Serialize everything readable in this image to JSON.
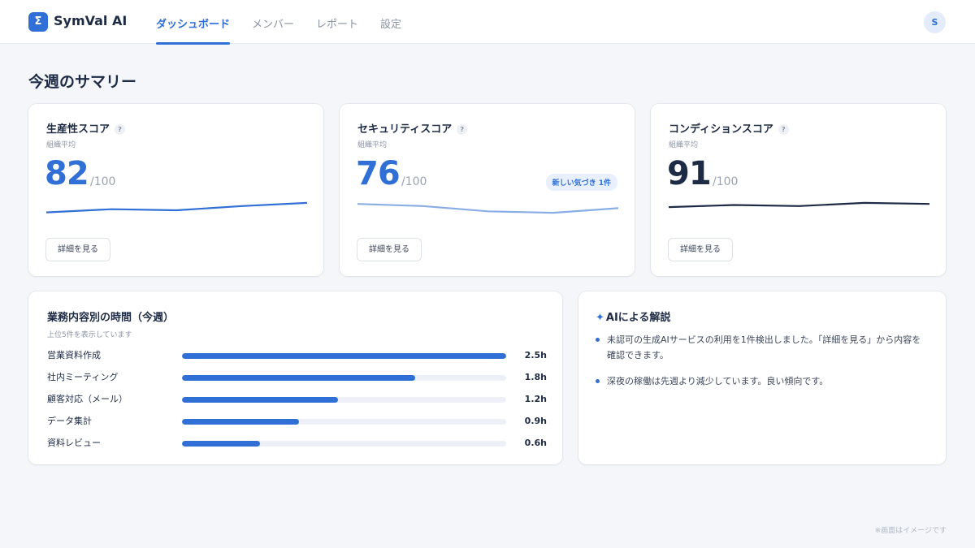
{
  "app": {
    "logo_glyph": "Σ",
    "name": "SymVal AI"
  },
  "nav": {
    "tabs": [
      {
        "label": "ダッシュボード",
        "active": true
      },
      {
        "label": "メンバー",
        "active": false
      },
      {
        "label": "レポート",
        "active": false
      },
      {
        "label": "設定",
        "active": false
      }
    ]
  },
  "user": {
    "avatar_initial": "S"
  },
  "page": {
    "title": "今週のサマリー"
  },
  "help_glyph": "?",
  "score_cards": [
    {
      "title": "生産性スコア",
      "subtitle": "組織平均",
      "value": "82",
      "max": "/100",
      "value_color": "#2f6fd6",
      "line_color": "#2f6fd6",
      "trend": [
        0.6,
        0.45,
        0.5,
        0.3,
        0.15
      ],
      "button": "詳細を見る"
    },
    {
      "title": "セキュリティスコア",
      "subtitle": "組織平均",
      "value": "76",
      "max": "/100",
      "badge": "新しい気づき 1件",
      "value_color": "#2f6fd6",
      "line_color": "#89aee6",
      "trend": [
        0.2,
        0.3,
        0.55,
        0.62,
        0.4
      ],
      "button": "詳細を見る"
    },
    {
      "title": "コンディションスコア",
      "subtitle": "組織平均",
      "value": "91",
      "max": "/100",
      "value_color": "#1e2b45",
      "line_color": "#1e2b45",
      "trend": [
        0.35,
        0.25,
        0.3,
        0.15,
        0.2
      ],
      "button": "詳細を見る"
    }
  ],
  "tasks": {
    "title": "業務内容別の時間（今週）",
    "subtitle": "上位5件を表示しています",
    "max_hours": 2.5,
    "items": [
      {
        "label": "営業資料作成",
        "hours": 2.5,
        "value": "2.5h"
      },
      {
        "label": "社内ミーティング",
        "hours": 1.8,
        "value": "1.8h"
      },
      {
        "label": "顧客対応（メール）",
        "hours": 1.2,
        "value": "1.2h"
      },
      {
        "label": "データ集計",
        "hours": 0.9,
        "value": "0.9h"
      },
      {
        "label": "資料レビュー",
        "hours": 0.6,
        "value": "0.6h"
      }
    ]
  },
  "ai": {
    "sparkle": "✦",
    "title": "AIによる解説",
    "points": [
      "未認可の生成AIサービスの利用を1件検出しました。「詳細を見る」から内容を確認できます。",
      "深夜の稼働は先週より減少しています。良い傾向です。"
    ]
  },
  "footnote": "※画面はイメージです",
  "colors": {
    "accent": "#2f6fd6",
    "navy": "#1e2b45",
    "background": "#f4f6fa"
  }
}
